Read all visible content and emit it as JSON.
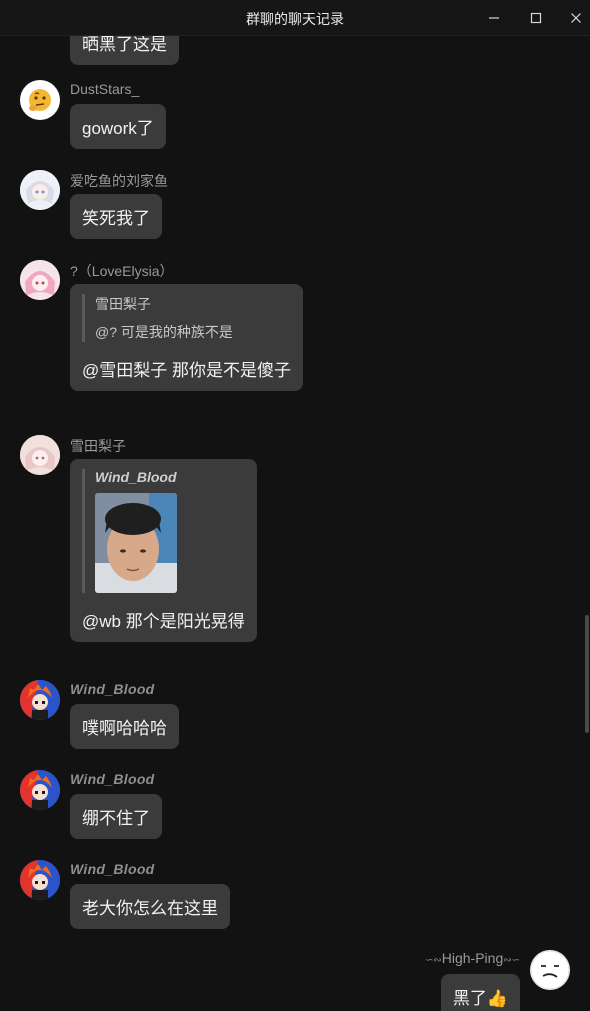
{
  "window": {
    "title": "群聊的聊天记录",
    "minimize_icon": "minimize-icon",
    "maximize_icon": "maximize-icon",
    "close_icon": "close-icon"
  },
  "messages": [
    {
      "sender": "",
      "text": "晒黑了这是",
      "avatar": "none"
    },
    {
      "sender": "DustStars_",
      "text": "gowork了",
      "avatar": "thinking-emoji"
    },
    {
      "sender": "爱吃鱼的刘家鱼",
      "text": "笑死我了",
      "avatar": "anime-girl-white"
    },
    {
      "sender": "?（LoveElysia）",
      "text": "@雪田梨子 那你是不是傻子",
      "avatar": "anime-girl-pink",
      "quote": {
        "sender": "雪田梨子",
        "text": "@? 可是我的种族不是"
      }
    },
    {
      "sender": "雪田梨子",
      "text": "@wb 那个是阳光晃得",
      "avatar": "anime-girl-soft",
      "quote": {
        "sender": "Wind_Blood",
        "image": "photo-of-boy"
      }
    },
    {
      "sender": "Wind_Blood",
      "text": "噗啊哈哈哈",
      "avatar": "orange-hair-character"
    },
    {
      "sender": "Wind_Blood",
      "text": "绷不住了",
      "avatar": "orange-hair-character"
    },
    {
      "sender": "Wind_Blood",
      "text": "老大你怎么在这里",
      "avatar": "orange-hair-character"
    },
    {
      "sender": "High-Ping",
      "text": "黑了👍",
      "avatar": "meh-face"
    }
  ],
  "colors": {
    "background": "#121212",
    "bubble": "#3b3b3b",
    "text": "#f2f2f2",
    "sender": "#9a9a9a"
  }
}
